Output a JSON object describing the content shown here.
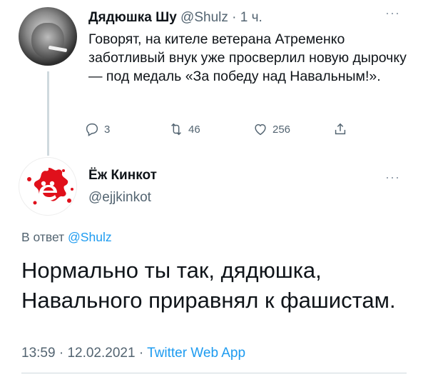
{
  "tweet1": {
    "name": "Дядюшка Шу",
    "handle": "@Shulz",
    "sep": "·",
    "time": "1 ч.",
    "more": "···",
    "text": "Говорят, на кителе ветерана Атременко заботливый внук уже просверлил новую дырочку — под медаль «За победу над Навальным!».",
    "actions": {
      "replies": "3",
      "retweets": "46",
      "likes": "256"
    }
  },
  "tweet2": {
    "name": "Ёж Кинкот",
    "handle": "@ejjkinkot",
    "more": "···",
    "reply_prefix": "В ответ",
    "reply_to": "@Shulz",
    "text": "Нормально ты так, дядюшка, Навального приравнял к фашистам.",
    "time": "13:59",
    "sep1": "·",
    "date": "12.02.2021",
    "sep2": "·",
    "source": "Twitter Web App"
  },
  "colors": {
    "link": "#1d9bf0",
    "muted": "#536471",
    "text": "#0f1419",
    "avatar_red": "#e0101b"
  },
  "icons": {
    "reply": "reply-icon",
    "retweet": "retweet-icon",
    "like": "heart-icon",
    "share": "share-icon",
    "more": "more-icon"
  }
}
